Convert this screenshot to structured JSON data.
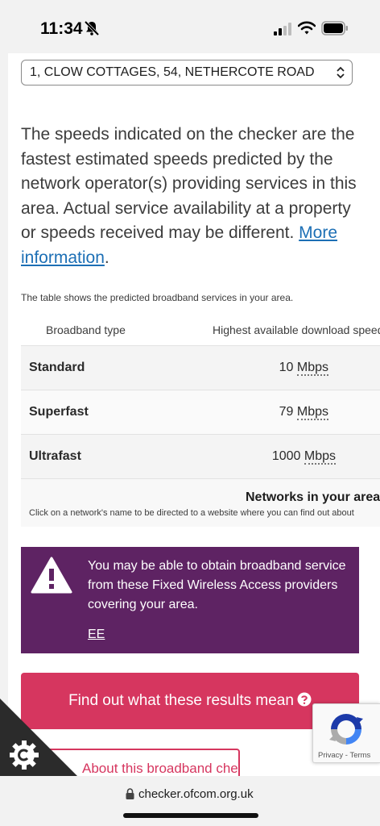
{
  "status_bar": {
    "time": "11:34"
  },
  "address": {
    "selected": "1, CLOW COTTAGES, 54, NETHERCOTE ROAD"
  },
  "disclaimer": {
    "text": "The speeds indicated on the checker are the fastest estimated speeds predicted by the network operator(s) providing services in this area. Actual service availability at a property or speeds received may be different.",
    "link_label": "More information",
    "trailing": "."
  },
  "table": {
    "caption": "The table shows the predicted broadband services in your area.",
    "headers": [
      "Broadband type",
      "Highest available download speed"
    ],
    "rows": [
      {
        "type": "Standard",
        "speed": "10",
        "unit": "Mbps"
      },
      {
        "type": "Superfast",
        "speed": "79",
        "unit": "Mbps"
      },
      {
        "type": "Ultrafast",
        "speed": "1000",
        "unit": "Mbps"
      }
    ],
    "networks_title": "Networks in your area",
    "networks_hint": "Click on a network's name to be directed to a website where you can find out about"
  },
  "fwa": {
    "text": "You may be able to obtain broadband service from these Fixed Wireless Access providers covering your area.",
    "provider": "EE"
  },
  "buttons": {
    "results": "Find out what these results mean",
    "about": "About this broadband checker"
  },
  "recaptcha": {
    "privacy": "Privacy",
    "separator": " - ",
    "terms": "Terms"
  },
  "url_bar": {
    "url": "checker.ofcom.org.uk"
  },
  "colors": {
    "fwa_background": "#5e2363",
    "accent": "#d6365f",
    "link": "#1c6fb5"
  }
}
